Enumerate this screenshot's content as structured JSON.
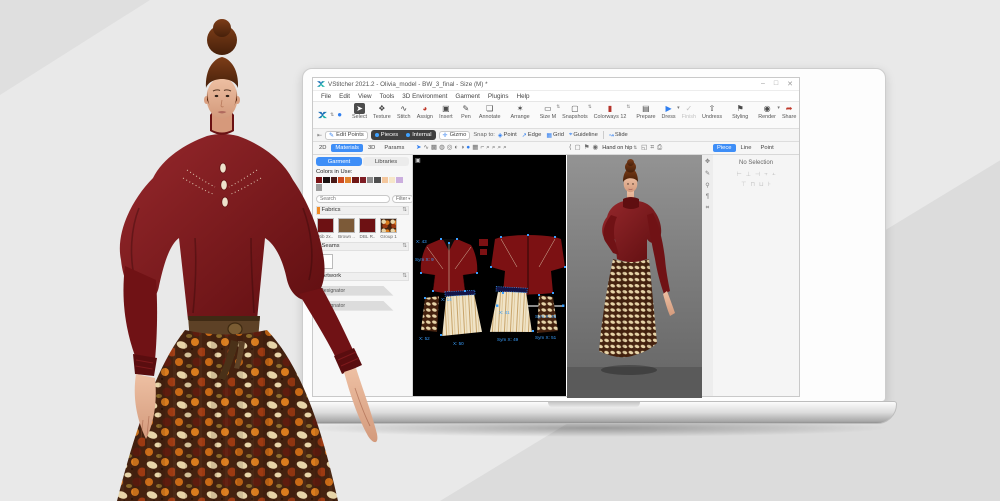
{
  "window": {
    "title": "VStitcher 2021.2 - Olivia_model - BW_3_final - Size (M) *",
    "controls": {
      "minimize": "–",
      "maximize": "□",
      "close": "✕"
    }
  },
  "menu": {
    "items": [
      "File",
      "Edit",
      "View",
      "Tools",
      "3D Environment",
      "Garment",
      "Plugins",
      "Help"
    ]
  },
  "toolbar": {
    "logo_glyph": "",
    "mode_dot_glyph": "●",
    "groups": [
      {
        "buttons": [
          {
            "label": "Select",
            "name": "select-tool-button",
            "icon": "cursor-icon",
            "glyph": "➤",
            "active": true
          },
          {
            "label": "Texture",
            "name": "texture-tool-button",
            "icon": "texture-icon",
            "glyph": "❖"
          },
          {
            "label": "Stitch",
            "name": "stitch-tool-button",
            "icon": "zigzag-stitch-icon",
            "glyph": "∿"
          },
          {
            "label": "Assign",
            "name": "assign-tool-button",
            "icon": "assign-ball-icon",
            "glyph": "◕",
            "glyph_color": "#c0392b"
          },
          {
            "label": "Insert",
            "name": "insert-tool-button",
            "icon": "insert-square-icon",
            "glyph": "▣"
          },
          {
            "label": "Pen",
            "name": "pen-tool-button",
            "icon": "pen-icon",
            "glyph": "✎"
          },
          {
            "label": "Annotate",
            "name": "annotate-tool-button",
            "icon": "annotate-icon",
            "glyph": "❏"
          }
        ]
      },
      {
        "buttons": [
          {
            "label": "Arrange",
            "name": "arrange-button",
            "icon": "mannequin-icon",
            "glyph": "✶"
          }
        ]
      },
      {
        "buttons": [
          {
            "label": "Size M",
            "name": "size-selector",
            "icon": "size-box-icon",
            "glyph": "▭",
            "stepper": true
          },
          {
            "label": "Snapshots",
            "name": "snapshots-selector",
            "icon": "snapshot-frame-icon",
            "glyph": "▢",
            "stepper": true
          },
          {
            "label": "Colorways 12",
            "name": "colorways-selector",
            "icon": "colorway-swatch-icon",
            "glyph": "▮",
            "glyph_color": "#b5332a",
            "stepper": true
          }
        ]
      },
      {
        "buttons": [
          {
            "label": "Prepare",
            "name": "prepare-button",
            "icon": "prepare-garment-icon",
            "glyph": "▤"
          },
          {
            "label": "Dress",
            "name": "dress-button",
            "icon": "play-icon",
            "glyph": "▶",
            "glyph_color": "#2f7ef0",
            "dropdown": true
          },
          {
            "label": "Finish",
            "name": "finish-button",
            "icon": "check-icon",
            "glyph": "✓",
            "disabled": true
          },
          {
            "label": "Undress",
            "name": "undress-button",
            "icon": "undress-icon",
            "glyph": "⇧"
          }
        ]
      },
      {
        "buttons": [
          {
            "label": "Styling",
            "name": "styling-button",
            "icon": "styling-pin-icon",
            "glyph": "⚑"
          }
        ]
      },
      {
        "buttons": [
          {
            "label": "Render",
            "name": "render-button",
            "icon": "camera-icon",
            "glyph": "◉",
            "dropdown": true
          },
          {
            "label": "Share",
            "name": "share-button",
            "icon": "share-icon",
            "glyph": "➦",
            "glyph_color": "#c0392b"
          }
        ]
      }
    ]
  },
  "toolbar2": {
    "collapse_glyph": "⇤",
    "edit_points": "Edit Points",
    "pieces": "Pieces",
    "internal": "Internal",
    "gizmo": "Gizmo",
    "snap_to": "Snap to:",
    "snaps": [
      {
        "label": "Point",
        "name": "snap-point",
        "glyph": "◈"
      },
      {
        "label": "Edge",
        "name": "snap-edge",
        "glyph": "↗"
      },
      {
        "label": "Grid",
        "name": "snap-grid",
        "glyph": "▦"
      },
      {
        "label": "Guideline",
        "name": "snap-guideline",
        "glyph": "⌖"
      }
    ],
    "slide": {
      "label": "Slide",
      "glyph": "↝"
    }
  },
  "view_tabs": {
    "items": [
      {
        "label": "2D",
        "name": "tab-2d"
      },
      {
        "label": "Materials",
        "name": "tab-materials",
        "active": true
      },
      {
        "label": "3D",
        "name": "tab-3d"
      },
      {
        "label": "Params",
        "name": "tab-params"
      }
    ]
  },
  "pattern_toolbar": {
    "icons": [
      {
        "name": "cursor-icon",
        "glyph": "➤",
        "color": "#2f7ef0"
      },
      {
        "name": "stitch-tool-icon",
        "glyph": "∿"
      },
      {
        "name": "piece-solid-icon",
        "glyph": "▩"
      },
      {
        "name": "shaded-sphere-icon",
        "glyph": "◍"
      },
      {
        "name": "outline-sphere-icon",
        "glyph": "◎"
      },
      {
        "name": "half-sphere-icon",
        "glyph": "◐"
      },
      {
        "name": "contrast-sphere-icon",
        "glyph": "◑"
      },
      {
        "name": "active-mode-icon",
        "glyph": "●",
        "color": "#2f7ef0"
      },
      {
        "name": "grid-icon",
        "glyph": "▦"
      },
      {
        "name": "corner-ruler-icon",
        "glyph": "⌐"
      },
      {
        "name": "zoom-in-icon",
        "glyph": "⌕"
      },
      {
        "name": "zoom-out-icon",
        "glyph": "⌕"
      },
      {
        "name": "zoom-fit-icon",
        "glyph": "⌕"
      },
      {
        "name": "zoom-region-icon",
        "glyph": "⌕"
      }
    ]
  },
  "viewport_toolbar": {
    "left_icons": [
      {
        "name": "back-arrow-icon",
        "glyph": "⟨"
      },
      {
        "name": "frame-icon",
        "glyph": "▢"
      },
      {
        "name": "avatar-icon",
        "glyph": "⚑"
      },
      {
        "name": "camera-icon",
        "glyph": "◉"
      }
    ],
    "pose": {
      "value": "Hand on hip"
    },
    "right_icons": [
      {
        "name": "turntable-icon",
        "glyph": "◱"
      },
      {
        "name": "screenshot-icon",
        "glyph": "⌗"
      },
      {
        "name": "export-icon",
        "glyph": "⎙"
      }
    ]
  },
  "left_panel": {
    "tabs": [
      {
        "label": "Garment",
        "name": "tab-garment",
        "active": true
      },
      {
        "label": "Libraries",
        "name": "tab-libraries"
      }
    ],
    "colors_label": "Colors in Use:",
    "colors": [
      "#7a1114",
      "#1a1212",
      "#4a1a17",
      "#cc4a21",
      "#e0832d",
      "#701715",
      "#7e1d24",
      "#8d8d8d",
      "#4e4e4e",
      "#f4c79e",
      "#f6e7c9",
      "#cbaede",
      "#9c9c9c"
    ],
    "search_placeholder": "Search",
    "filter_label": "Filter",
    "view_toggles": [
      {
        "name": "list-view-icon",
        "glyph": "≡"
      },
      {
        "name": "grid-view-icon",
        "glyph": "▦"
      },
      {
        "name": "detail-view-icon",
        "glyph": "⧉"
      }
    ],
    "sections": {
      "fabrics": {
        "title": "Fabrics",
        "accent": "#f08a24",
        "sort_glyph": "⇅",
        "items": [
          {
            "label": "Rib 2x..",
            "kind": "rib",
            "swatch": "#6d1113"
          },
          {
            "label": "Brown ..",
            "swatch": "#7c5a38"
          },
          {
            "label": "DBL R..",
            "swatch": "#6d1113"
          },
          {
            "label": "Group 1",
            "kind": "floral"
          }
        ]
      },
      "seams": {
        "title": "Seams",
        "accent": "#7ac143",
        "sort_glyph": "⇅"
      },
      "artwork": {
        "title": "Artwork",
        "accent": "#9b59b6",
        "sort_glyph": "⇅"
      }
    },
    "collapsed_tabs": [
      "Designator",
      "Designator"
    ]
  },
  "right_panel": {
    "tabs": [
      {
        "label": "Piece",
        "name": "tab-piece",
        "active": true
      },
      {
        "label": "Line",
        "name": "tab-line"
      },
      {
        "label": "Point",
        "name": "tab-point"
      }
    ],
    "empty_state": "No Selection",
    "icon_row1": [
      "⊢",
      "⊥",
      "⊣",
      "⫟",
      "⫠"
    ],
    "icon_row2": [
      "⊤",
      "⊓",
      "⊔",
      "⊦"
    ]
  },
  "side_strip_icons": [
    {
      "name": "link-icon",
      "glyph": "✥"
    },
    {
      "name": "pencil-icon",
      "glyph": "✎"
    },
    {
      "name": "pin-icon",
      "glyph": "⚲"
    },
    {
      "name": "text-icon",
      "glyph": "¶"
    },
    {
      "name": "measure-icon",
      "glyph": "⌗"
    }
  ],
  "pattern_view": {
    "labels": [
      "X: 43",
      "Sym X: 9",
      "X: 14",
      "X: 41",
      "Sym X: 45",
      "X: 52",
      "X: 50",
      "Sym X: 49",
      "Sym X: 51"
    ]
  },
  "colors": {
    "accent_blue": "#2f7ef0",
    "blouse": "#7c1416",
    "hair": "#6e3317",
    "skin": "#e4b296"
  }
}
